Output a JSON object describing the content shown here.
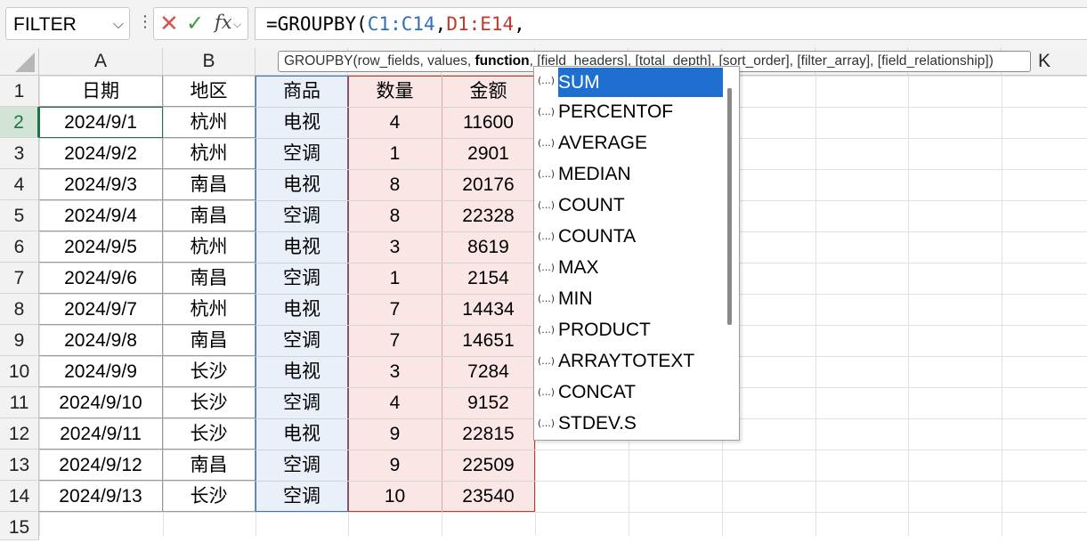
{
  "formula_bar": {
    "name_box": "FILTER",
    "cancel_glyph": "✕",
    "confirm_glyph": "✓",
    "fx_label": "fx",
    "formula_prefix": "=GROUPBY(",
    "formula_arg1": "C1:C14",
    "formula_sep1": ",",
    "formula_arg2": "D1:E14",
    "formula_sep2": ","
  },
  "column_headers": [
    "A",
    "B",
    "",
    "",
    "",
    "",
    "",
    "",
    "",
    "",
    "K"
  ],
  "row_headers": [
    "1",
    "2",
    "3",
    "4",
    "5",
    "6",
    "7",
    "8",
    "9",
    "10",
    "11",
    "12",
    "13",
    "14",
    "15"
  ],
  "table": {
    "headers": [
      "日期",
      "地区",
      "商品",
      "数量",
      "金额"
    ],
    "rows": [
      [
        "2024/9/1",
        "杭州",
        "电视",
        "4",
        "11600"
      ],
      [
        "2024/9/2",
        "杭州",
        "空调",
        "1",
        "2901"
      ],
      [
        "2024/9/3",
        "南昌",
        "电视",
        "8",
        "20176"
      ],
      [
        "2024/9/4",
        "南昌",
        "空调",
        "8",
        "22328"
      ],
      [
        "2024/9/5",
        "杭州",
        "电视",
        "3",
        "8619"
      ],
      [
        "2024/9/6",
        "南昌",
        "空调",
        "1",
        "2154"
      ],
      [
        "2024/9/7",
        "杭州",
        "电视",
        "7",
        "14434"
      ],
      [
        "2024/9/8",
        "南昌",
        "空调",
        "7",
        "14651"
      ],
      [
        "2024/9/9",
        "长沙",
        "电视",
        "3",
        "7284"
      ],
      [
        "2024/9/10",
        "长沙",
        "空调",
        "4",
        "9152"
      ],
      [
        "2024/9/11",
        "长沙",
        "电视",
        "9",
        "22815"
      ],
      [
        "2024/9/12",
        "南昌",
        "空调",
        "9",
        "22509"
      ],
      [
        "2024/9/13",
        "长沙",
        "空调",
        "10",
        "23540"
      ]
    ]
  },
  "tooltip": {
    "before": "GROUPBY(row_fields, values, ",
    "current": "function",
    "after": ", [field_headers], [total_depth], [sort_order], [filter_array], [field_relationship])"
  },
  "autocomplete": {
    "icon": "(...)",
    "items": [
      "SUM",
      "PERCENTOF",
      "AVERAGE",
      "MEDIAN",
      "COUNT",
      "COUNTA",
      "MAX",
      "MIN",
      "PRODUCT",
      "ARRAYTOTEXT",
      "CONCAT",
      "STDEV.S"
    ],
    "selected": "SUM"
  },
  "colors": {
    "selection_green": "#217346",
    "range_blue": "#3a74c4",
    "range_red": "#c0392b",
    "highlight_blue": "#1e6fd0"
  }
}
